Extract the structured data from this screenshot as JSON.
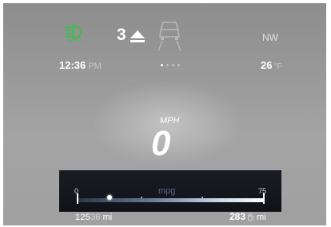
{
  "top": {
    "headlight": {
      "icon": "auto-headlight-icon",
      "label": "AUTO",
      "color": "#37c24a"
    },
    "gear": {
      "value": "3",
      "icon": "shift-up-arrow-icon"
    },
    "car_icon": "lane-assist-car-icon",
    "compass": "NW"
  },
  "status": {
    "time": "12:36",
    "ampm": "PM",
    "temperature": "26",
    "temperature_unit": "°F",
    "page_dots": {
      "count": 4,
      "active": 0
    }
  },
  "speed": {
    "unit": "MPH",
    "value": "0"
  },
  "mpg": {
    "label": "mpg",
    "min": "0",
    "max": "75",
    "current": 13
  },
  "bottom": {
    "odometer_main": "125",
    "odometer_faint": "36",
    "odometer_unit": "mi",
    "range": "283",
    "range_icon": "fuel-pump-icon",
    "range_unit": "mi"
  }
}
